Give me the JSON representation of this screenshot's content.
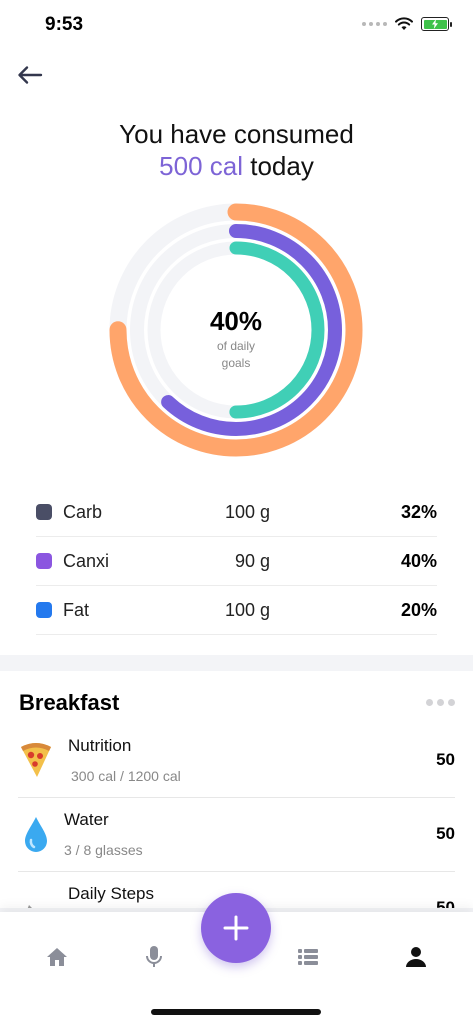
{
  "status_bar": {
    "time": "9:53"
  },
  "header": {
    "headline_line1": "You have consumed",
    "headline_accent": "500 cal",
    "headline_tail": " today"
  },
  "ring": {
    "percent_label": "40%",
    "caption_line1": "of daily",
    "caption_line2": "goals",
    "progress": [
      {
        "name": "outer",
        "color": "#ffa56b",
        "fraction": 0.75
      },
      {
        "name": "middle",
        "color": "#7760dc",
        "fraction": 0.62
      },
      {
        "name": "inner",
        "color": "#40cfb6",
        "fraction": 0.5
      }
    ],
    "track_color": "#f3f4f7"
  },
  "macros": [
    {
      "name": "Carb",
      "amount": "100 g",
      "percent": "32%",
      "color": "#4a4e66"
    },
    {
      "name": "Canxi",
      "amount": "90 g",
      "percent": "40%",
      "color": "#8b56e0"
    },
    {
      "name": "Fat",
      "amount": "100 g",
      "percent": "20%",
      "color": "#2479ee"
    }
  ],
  "breakfast": {
    "title": "Breakfast",
    "entries": [
      {
        "icon": "pizza-icon",
        "title": "Nutrition",
        "subtitle": "300 cal / 1200 cal",
        "value": "50"
      },
      {
        "icon": "water-drop-icon",
        "title": "Water",
        "subtitle": "3 / 8 glasses",
        "value": "50"
      },
      {
        "icon": "shoe-icon",
        "title": "Daily Steps",
        "subtitle": "",
        "value": "50"
      }
    ]
  },
  "nav": {
    "items": [
      "home-icon",
      "microphone-icon",
      "list-icon",
      "profile-icon"
    ],
    "fab_icon": "plus-icon",
    "accent": "#8a62e0"
  }
}
